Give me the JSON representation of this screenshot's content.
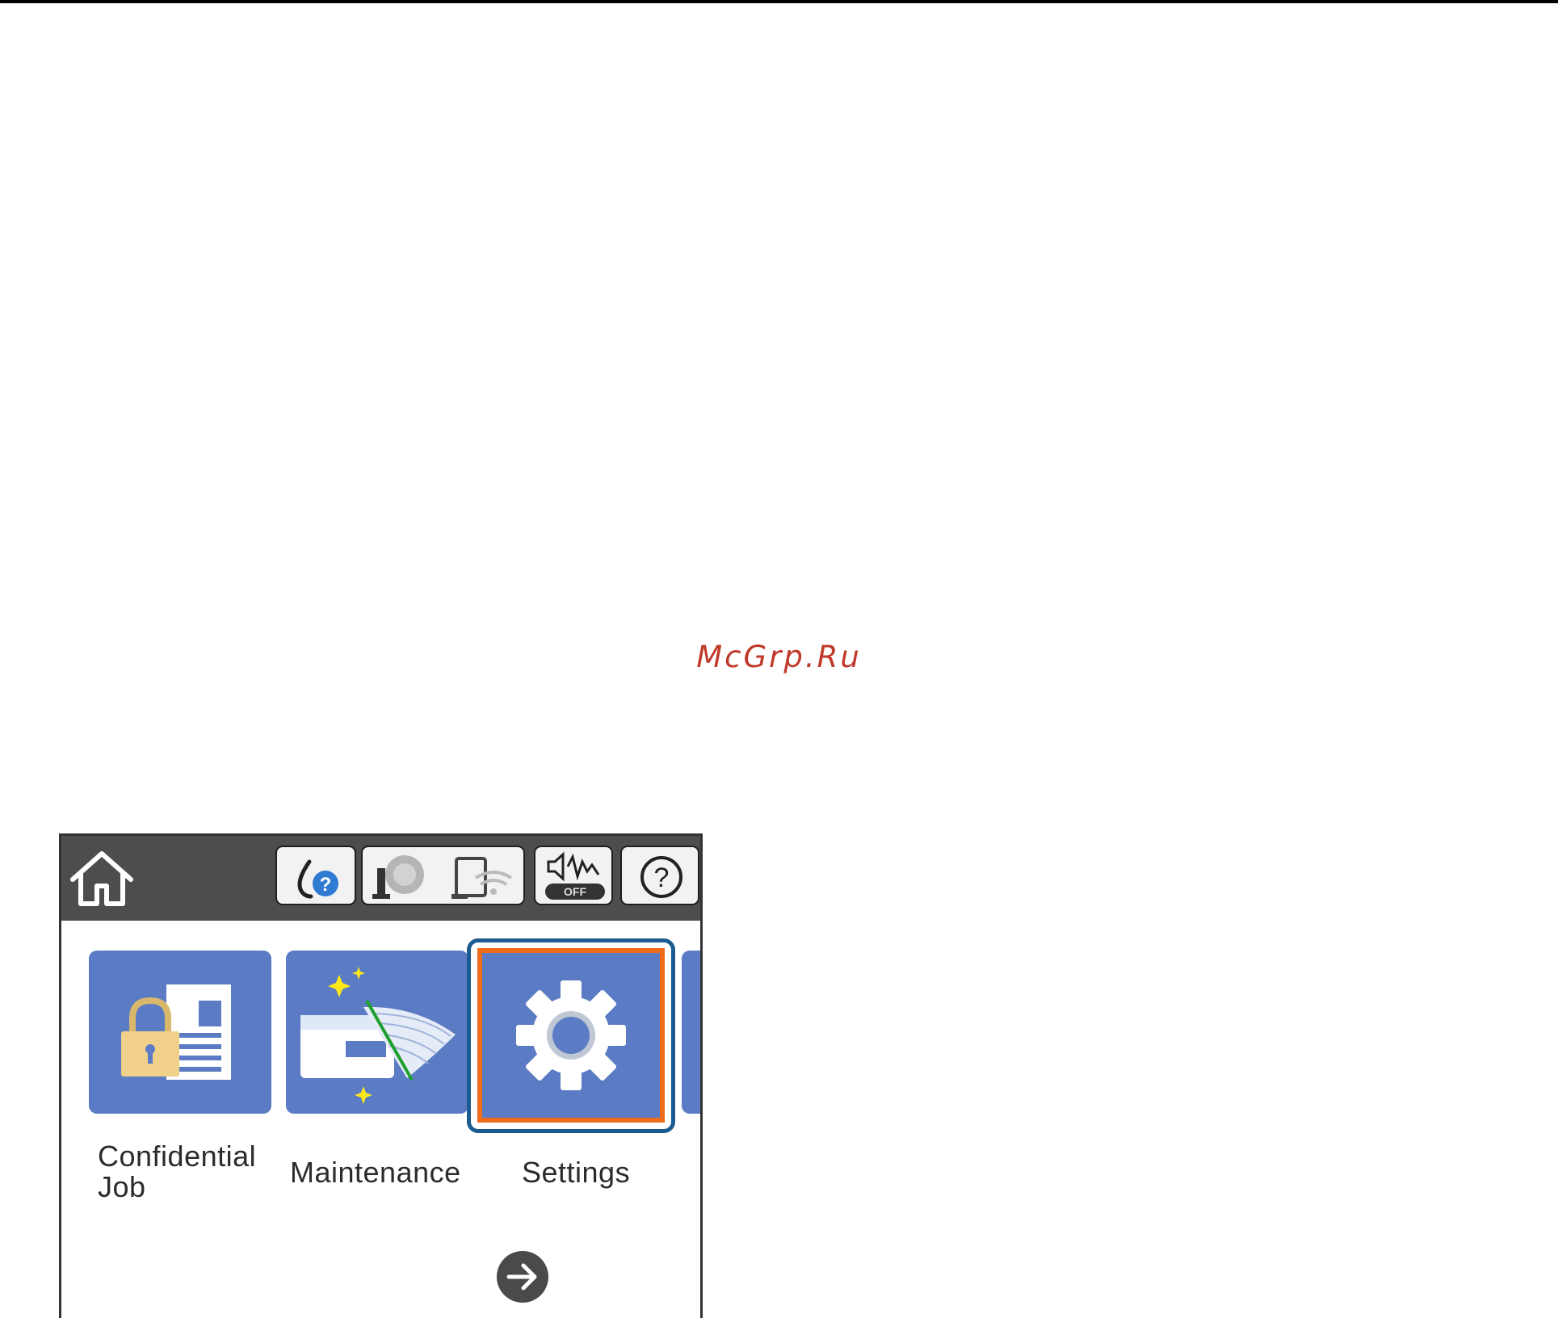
{
  "watermark": {
    "text": "McGrp.Ru",
    "color": "#c0392b"
  },
  "panel": {
    "topbar": {
      "home": {
        "icon": "home-icon"
      },
      "status_icons": [
        {
          "icon": "ink-status-icon"
        },
        {
          "icon": "network-status-icon"
        },
        {
          "icon": "wifi-direct-icon"
        },
        {
          "icon": "quiet-mode-icon",
          "label": "OFF"
        },
        {
          "icon": "help-icon"
        }
      ]
    },
    "tiles": [
      {
        "icon": "confidential-job-icon",
        "label": "Confidential\nJob"
      },
      {
        "icon": "maintenance-icon",
        "label": "Maintenance"
      },
      {
        "icon": "settings-gear-icon",
        "label": "Settings",
        "highlighted": true
      }
    ],
    "next": {
      "icon": "arrow-right-icon"
    },
    "colors": {
      "topbar": "#4d4d4f",
      "tile": "#5b7cc4",
      "highlight_outer": "#1c5b8f",
      "highlight_inner": "#ef6c1a"
    }
  }
}
